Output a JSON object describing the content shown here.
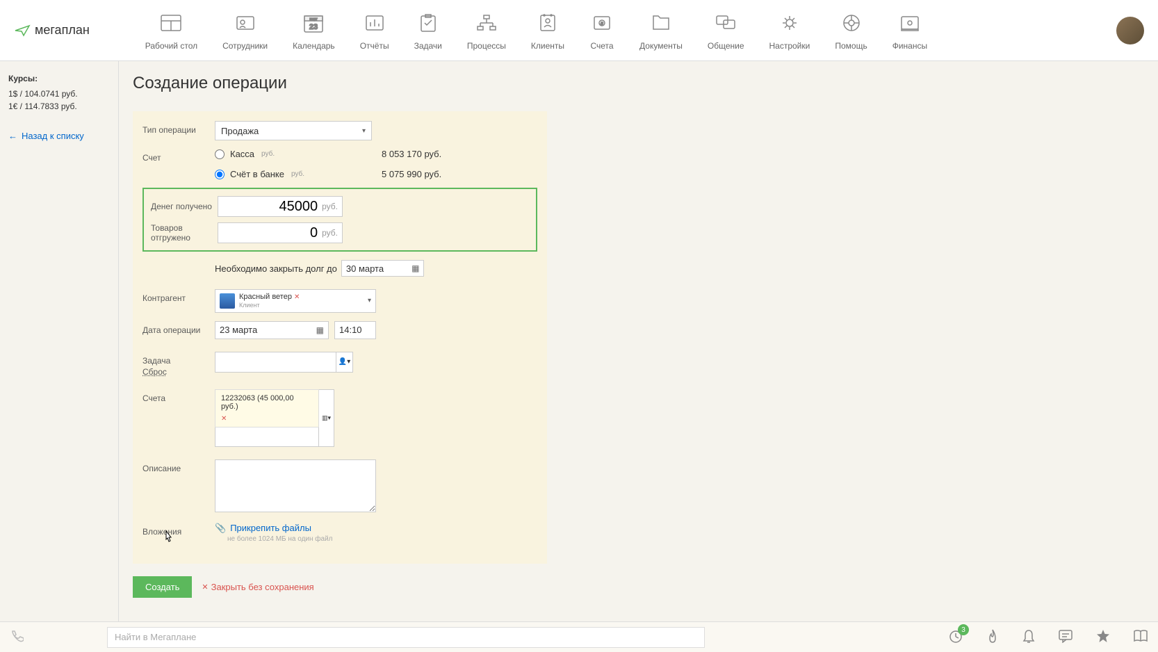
{
  "logo": "мегаплан",
  "nav": {
    "desktop": "Рабочий стол",
    "employees": "Сотрудники",
    "calendar": "Календарь",
    "calendar_day": "23",
    "calendar_month": "март",
    "reports": "Отчёты",
    "tasks": "Задачи",
    "processes": "Процессы",
    "clients": "Клиенты",
    "accounts": "Счета",
    "documents": "Документы",
    "communication": "Общение",
    "settings": "Настройки",
    "help": "Помощь",
    "finances": "Финансы"
  },
  "sidebar": {
    "rates_title": "Курсы:",
    "usd_rate": "1$ / 104.0741 руб.",
    "eur_rate": "1€ / 114.7833 руб.",
    "back_link": "Назад к списку"
  },
  "page_title": "Создание операции",
  "form": {
    "operation_type_label": "Тип операции",
    "operation_type_value": "Продажа",
    "account_label": "Счет",
    "account_cash": "Касса",
    "account_bank": "Счёт в банке",
    "currency_small": "руб.",
    "cash_balance": "8 053 170 руб.",
    "bank_balance": "5 075 990 руб.",
    "money_received_label": "Денег получено",
    "money_received_value": "45000",
    "goods_shipped_label": "Товаров отгружено",
    "goods_shipped_value": "0",
    "debt_text": "Необходимо закрыть долг до",
    "debt_date": "30 марта",
    "contractor_label": "Контрагент",
    "contractor_name": "Красный ветер",
    "contractor_sub": "Клиент",
    "operation_date_label": "Дата операции",
    "operation_date": "23 марта",
    "operation_time": "14:10",
    "task_label": "Задача",
    "task_reset": "Сброс",
    "invoices_label": "Счета",
    "invoice_value": "12232063 (45 000,00 руб.)",
    "description_label": "Описание",
    "attachments_label": "Вложения",
    "attach_link": "Прикрепить файлы",
    "attach_hint": "не более 1024 МБ на один файл",
    "create_btn": "Создать",
    "close_btn": "Закрыть без сохранения"
  },
  "bottom": {
    "search_placeholder": "Найти в Мегаплане",
    "badge": "3"
  }
}
